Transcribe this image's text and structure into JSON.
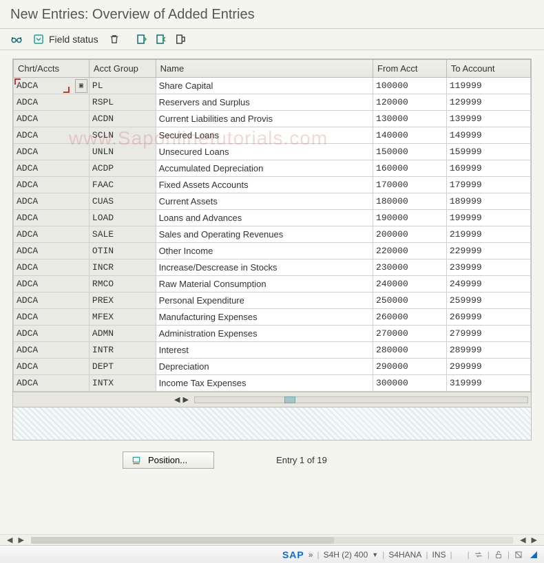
{
  "header": {
    "title": "New Entries: Overview of Added Entries"
  },
  "toolbar": {
    "field_status": "Field status"
  },
  "columns": {
    "chrt": "Chrt/Accts",
    "grp": "Acct Group",
    "name": "Name",
    "from": "From Acct",
    "to": "To Account"
  },
  "rows": [
    {
      "chrt": "ADCA",
      "grp": "PL",
      "name": "Share Capital",
      "from": "100000",
      "to": "119999"
    },
    {
      "chrt": "ADCA",
      "grp": "RSPL",
      "name": "Reservers and Surplus",
      "from": "120000",
      "to": "129999"
    },
    {
      "chrt": "ADCA",
      "grp": "ACDN",
      "name": "Current Liabilities and Provis",
      "from": "130000",
      "to": "139999"
    },
    {
      "chrt": "ADCA",
      "grp": "SCLN",
      "name": "Secured Loans",
      "from": "140000",
      "to": "149999"
    },
    {
      "chrt": "ADCA",
      "grp": "UNLN",
      "name": "Unsecured Loans",
      "from": "150000",
      "to": "159999"
    },
    {
      "chrt": "ADCA",
      "grp": "ACDP",
      "name": "Accumulated Depreciation",
      "from": "160000",
      "to": "169999"
    },
    {
      "chrt": "ADCA",
      "grp": "FAAC",
      "name": "Fixed Assets Accounts",
      "from": "170000",
      "to": "179999"
    },
    {
      "chrt": "ADCA",
      "grp": "CUAS",
      "name": "Current Assets",
      "from": "180000",
      "to": "189999"
    },
    {
      "chrt": "ADCA",
      "grp": "LOAD",
      "name": "Loans and Advances",
      "from": "190000",
      "to": "199999"
    },
    {
      "chrt": "ADCA",
      "grp": "SALE",
      "name": "Sales and Operating Revenues",
      "from": "200000",
      "to": "219999"
    },
    {
      "chrt": "ADCA",
      "grp": "OTIN",
      "name": "Other Income",
      "from": "220000",
      "to": "229999"
    },
    {
      "chrt": "ADCA",
      "grp": "INCR",
      "name": "Increase/Descrease in Stocks",
      "from": "230000",
      "to": "239999"
    },
    {
      "chrt": "ADCA",
      "grp": "RMCO",
      "name": "Raw Material Consumption",
      "from": "240000",
      "to": "249999"
    },
    {
      "chrt": "ADCA",
      "grp": "PREX",
      "name": "Personal Expenditure",
      "from": "250000",
      "to": "259999"
    },
    {
      "chrt": "ADCA",
      "grp": "MFEX",
      "name": "Manufacturing Expenses",
      "from": "260000",
      "to": "269999"
    },
    {
      "chrt": "ADCA",
      "grp": "ADMN",
      "name": "Administration Expenses",
      "from": "270000",
      "to": "279999"
    },
    {
      "chrt": "ADCA",
      "grp": "INTR",
      "name": "Interest",
      "from": "280000",
      "to": "289999"
    },
    {
      "chrt": "ADCA",
      "grp": "DEPT",
      "name": "Depreciation",
      "from": "290000",
      "to": "299999"
    },
    {
      "chrt": "ADCA",
      "grp": "INTX",
      "name": "Income Tax Expenses",
      "from": "300000",
      "to": "319999"
    }
  ],
  "footer": {
    "position_label": "Position...",
    "entry_text": "Entry 1 of 19"
  },
  "statusbar": {
    "sap": "SAP",
    "system": "S4H (2) 400",
    "host": "S4HANA",
    "mode": "INS"
  },
  "watermark": "www.Saponlinetutorials.com"
}
